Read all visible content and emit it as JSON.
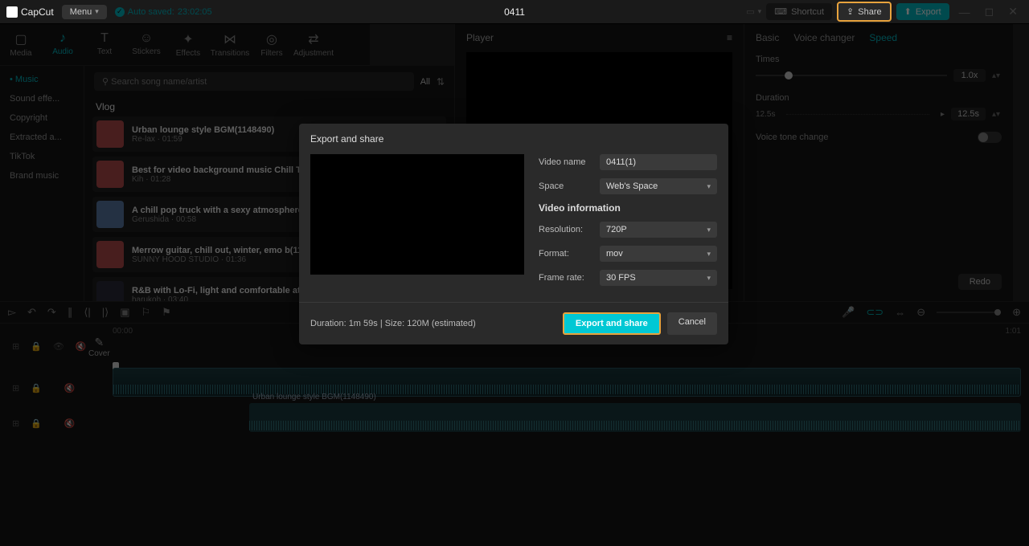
{
  "topbar": {
    "brand": "CapCut",
    "menu": "Menu",
    "autosaved_prefix": "Auto saved:",
    "autosaved_time": "23:02:05",
    "project": "0411",
    "shortcut": "Shortcut",
    "share": "Share",
    "export": "Export"
  },
  "media_tabs": [
    "Media",
    "Audio",
    "Text",
    "Stickers",
    "Effects",
    "Transitions",
    "Filters",
    "Adjustment"
  ],
  "media_tab_icons": [
    "▢",
    "♪",
    "T",
    "☺",
    "✦",
    "⋈",
    "◎",
    "⇄"
  ],
  "media_active": 1,
  "side_categories": [
    "Music",
    "Sound effe...",
    "Copyright",
    "Extracted a...",
    "TikTok",
    "Brand music"
  ],
  "side_active": 0,
  "search_placeholder": "Search song name/artist",
  "all_label": "All",
  "section": "Vlog",
  "tracks": [
    {
      "title": "Urban lounge style BGM(1148490)",
      "meta": "Re-lax · 01:59",
      "thumb": ""
    },
    {
      "title": "Best for video background music Chill Trap",
      "meta": "Kih · 01:28",
      "thumb": ""
    },
    {
      "title": "A chill pop truck with a sexy atmosphere ♪",
      "meta": "Gerushida · 00:58",
      "thumb": "blue"
    },
    {
      "title": "Merrow guitar, chill out, winter, emo b(115",
      "meta": "SUNNY HOOD STUDIO · 01:36",
      "thumb": ""
    },
    {
      "title": "R&B with Lo-Fi, light and comfortable atm",
      "meta": "harukoh · 03:40",
      "thumb": "dark"
    }
  ],
  "player_label": "Player",
  "right": {
    "tabs": [
      "Basic",
      "Voice changer",
      "Speed"
    ],
    "active": 2,
    "times_label": "Times",
    "times_value": "1.0x",
    "duration_label": "Duration",
    "duration_range": "12.5s",
    "duration_value": "12.5s",
    "tone_label": "Voice tone change",
    "redo": "Redo"
  },
  "time_start": "00:00",
  "time_end": "1:01",
  "audio_track_label": "Urban lounge style BGM(1148490)",
  "modal": {
    "title": "Export and share",
    "video_name_label": "Video name",
    "video_name_value": "0411(1)",
    "space_label": "Space",
    "space_value": "Web's Space",
    "info_header": "Video information",
    "resolution_label": "Resolution:",
    "resolution_value": "720P",
    "format_label": "Format:",
    "format_value": "mov",
    "framerate_label": "Frame rate:",
    "framerate_value": "30 FPS",
    "footer_info": "Duration: 1m 59s | Size: 120M (estimated)",
    "primary": "Export and share",
    "cancel": "Cancel"
  }
}
